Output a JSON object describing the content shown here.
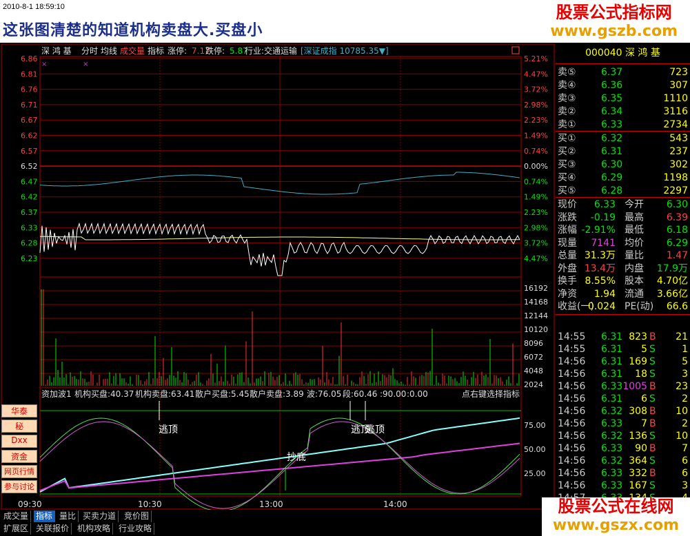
{
  "header": {
    "datetime": "2010-8-1 18:59:10",
    "caption": "这张图清楚的知道机构卖盘大.买盘小"
  },
  "watermark_top": {
    "line1": "股票公式指标网",
    "line2": "www.gszb.com"
  },
  "watermark_bottom": {
    "line1": "股票公式在线网",
    "line2": "www.gszx.com"
  },
  "toolbar": {
    "stock": "深 鸿 基",
    "items": [
      "分时",
      "均线",
      "成交量",
      "指标"
    ],
    "zhangting_label": "涨停:",
    "zhangting": "7.17",
    "dieting_label": "跌停:",
    "dieting": "5.87",
    "industry": "行业:交通运输",
    "index_box": "[深证成指 10785.35▼]"
  },
  "price_axis_left": [
    "6.86",
    "6.81",
    "6.76",
    "6.71",
    "6.67",
    "6.62",
    "6.57",
    "6.52",
    "6.47",
    "6.42",
    "6.37",
    "6.33",
    "6.28",
    "6.23"
  ],
  "pct_axis_right": [
    "5.21%",
    "4.47%",
    "3.72%",
    "2.98%",
    "2.23%",
    "1.49%",
    "0.74%",
    "0.00%",
    "0.74%",
    "1.49%",
    "2.23%",
    "2.98%",
    "3.72%",
    "4.47%"
  ],
  "volume_axis": [
    "16192",
    "14168",
    "12144",
    "10120",
    "8096",
    "6072",
    "4048",
    "2024"
  ],
  "indicator": {
    "title": "资加波1",
    "labels": [
      "机构买盘:40.37",
      "机构卖盘:63.41",
      "散户买盘:5.45",
      "散户卖盘:3.89",
      "波:76.05",
      "段:60.46",
      ":90.00",
      ":0.00"
    ],
    "hint": "点右键选择指标",
    "axis": [
      "75.00",
      "50.00",
      "25.00"
    ],
    "ann_top1": "逃顶",
    "ann_top2": "逃顶",
    "ann_top3": "逃顶",
    "ann_bottom": "抄底"
  },
  "time_axis": [
    "09:30",
    "10:30",
    "13:00",
    "14:00"
  ],
  "side_buttons": [
    "华泰",
    "秘",
    "Dxx",
    "资金",
    "网页行情",
    "参与讨论"
  ],
  "quote": {
    "code_name": "000040 深 鸿 基",
    "sell": [
      {
        "l": "卖⑤",
        "p": "6.37",
        "v": "723"
      },
      {
        "l": "卖④",
        "p": "6.36",
        "v": "307"
      },
      {
        "l": "卖③",
        "p": "6.35",
        "v": "1110"
      },
      {
        "l": "卖②",
        "p": "6.34",
        "v": "3116"
      },
      {
        "l": "卖①",
        "p": "6.33",
        "v": "2734"
      }
    ],
    "buy": [
      {
        "l": "买①",
        "p": "6.32",
        "v": "543"
      },
      {
        "l": "买②",
        "p": "6.31",
        "v": "237"
      },
      {
        "l": "买③",
        "p": "6.30",
        "v": "302"
      },
      {
        "l": "买④",
        "p": "6.29",
        "v": "1198"
      },
      {
        "l": "买⑤",
        "p": "6.28",
        "v": "2297"
      }
    ],
    "stats": [
      [
        "现价",
        "6.33",
        "今开",
        "6.30"
      ],
      [
        "涨跌",
        "-0.19",
        "最高",
        "6.39"
      ],
      [
        "涨幅",
        "-2.91%",
        "最低",
        "6.18"
      ],
      [
        "现量",
        "7141",
        "均价",
        "6.29"
      ],
      [
        "总量",
        "31.3万",
        "量比",
        "1.47"
      ],
      [
        "外盘",
        "13.4万",
        "内盘",
        "17.9万"
      ],
      [
        "换手",
        "8.55%",
        "股本",
        "4.70亿"
      ],
      [
        "净资",
        "1.94",
        "流通",
        "3.66亿"
      ],
      [
        "收益(一)",
        "0.024",
        "PE(动)",
        "66.6"
      ]
    ],
    "ticks": [
      [
        "14:55",
        "6.31",
        "823",
        "B",
        "21"
      ],
      [
        "14:55",
        "6.31",
        "5",
        "S",
        "1"
      ],
      [
        "14:56",
        "6.31",
        "169",
        "S",
        "5"
      ],
      [
        "14:56",
        "6.31",
        "18",
        "S",
        "3"
      ],
      [
        "14:56",
        "6.33",
        "1005",
        "B",
        "23"
      ],
      [
        "14:56",
        "6.31",
        "6",
        "S",
        "2"
      ],
      [
        "14:56",
        "6.32",
        "308",
        "B",
        "10"
      ],
      [
        "14:56",
        "6.33",
        "7",
        "B",
        "2"
      ],
      [
        "14:56",
        "6.32",
        "136",
        "S",
        "10"
      ],
      [
        "14:56",
        "6.33",
        "90",
        "B",
        "7"
      ],
      [
        "14:56",
        "6.32",
        "364",
        "S",
        "6"
      ],
      [
        "14:56",
        "6.33",
        "332",
        "B",
        "6"
      ],
      [
        "14:56",
        "6.33",
        "167",
        "S",
        "3"
      ],
      [
        "14:57",
        "6.33",
        "134",
        "S",
        "4"
      ]
    ]
  },
  "bottom_tabs_row1": [
    "成交量",
    "指标",
    "量比",
    "买卖力道",
    "竞价图"
  ],
  "bottom_tabs_row2": [
    "扩展区",
    "关联报价",
    "机构攻略",
    "行业攻略"
  ],
  "colors": {
    "up": "#ff3333",
    "down": "#00e600",
    "grid": "#b00000",
    "price_line": "#ffffff",
    "avg_line": "#ffff99",
    "index_line": "#3fb0c8"
  }
}
